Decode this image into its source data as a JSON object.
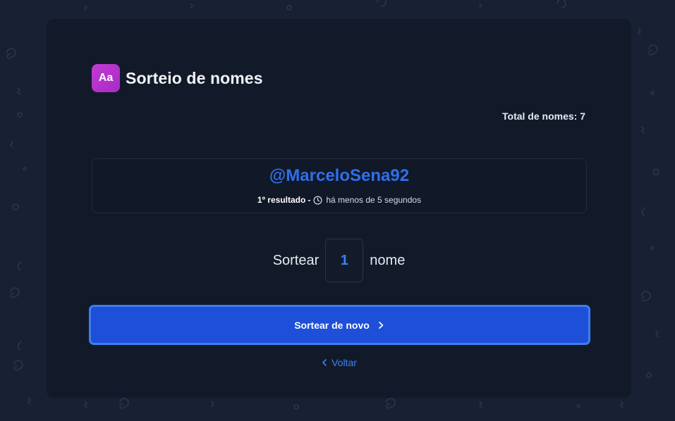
{
  "header": {
    "icon_text": "Aa",
    "title": "Sorteio de nomes"
  },
  "stats": {
    "total_label": "Total de nomes: 7"
  },
  "result": {
    "name": "@MarceloSena92",
    "position": "1º resultado",
    "separator": "-",
    "time": "há menos de 5 segundos"
  },
  "draw": {
    "prefix": "Sortear",
    "quantity": "1",
    "suffix": "nome"
  },
  "actions": {
    "redraw_label": "Sortear de novo",
    "back_label": "Voltar"
  },
  "colors": {
    "background": "#172133",
    "card": "#121a29",
    "accent": "#1d4fd8",
    "link": "#3b82f6",
    "icon_gradient_start": "#c23ad6",
    "icon_gradient_end": "#a72bc4"
  },
  "icons": {
    "clock": "clock-icon",
    "next": "chevron-right-icon",
    "back": "chevron-left-icon"
  }
}
